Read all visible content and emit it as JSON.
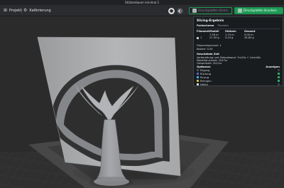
{
  "window": {
    "title": "Stützenbaum minimal 2"
  },
  "toolbar": {
    "tabs": [
      {
        "label": "Projekt",
        "icon": "project-icon"
      },
      {
        "label": "Kalibrierung",
        "icon": "calibration-icon"
      }
    ],
    "view_buttons": [
      {
        "icon": "view-solid-icon"
      },
      {
        "icon": "view-alt-icon"
      }
    ],
    "slice_buttons": [
      {
        "label": "Druckplatte slicen",
        "icon": "slice-icon"
      },
      {
        "label": "Druckplatte drucken",
        "icon": "print-icon"
      }
    ]
  },
  "panel": {
    "title": "Slicing-Ergebnis",
    "tabs": [
      "Farbschema",
      "Filament"
    ],
    "table": {
      "headers": [
        "Filament",
        "Modell",
        "Stützen",
        "Gesamt"
      ],
      "row": {
        "filament": "1",
        "modell": "7.26 m\n21.59 g",
        "stuetzen": "1.74 m\n5.24 g",
        "gesamt": "9.00 m\n26.83 g"
      }
    },
    "lines": [
      "Filamentwechsel: 1",
      "Kosten: 0.54"
    ],
    "timing": {
      "heading": "Geschätzte Zeit",
      "items": [
        "Vorbereitung und Zeitaufwand: 7m10s + 1min40s",
        "Modelldruckzeit:                      1h57m",
        "Gesamtzeit:                          2h21m"
      ]
    },
    "options": {
      "header_left": "Optionen",
      "header_right": "Anzeigen",
      "items": [
        {
          "label": "Eilgang",
          "color": "#4c4f55",
          "checked": false
        },
        {
          "label": "Rückzug",
          "color": "#5a66c7",
          "checked": true
        },
        {
          "label": "Einzug",
          "color": "#31b7e7",
          "checked": true
        },
        {
          "label": "Reinigen",
          "color": "#d2bd3a",
          "checked": true
        },
        {
          "label": "Nähte",
          "color": "#d7d7d7",
          "checked": false
        }
      ]
    }
  },
  "colors": {
    "accent_green": "#1f9b56",
    "viewport_bg": "#2b2b2b",
    "model_gray": "#a3a5a8"
  }
}
